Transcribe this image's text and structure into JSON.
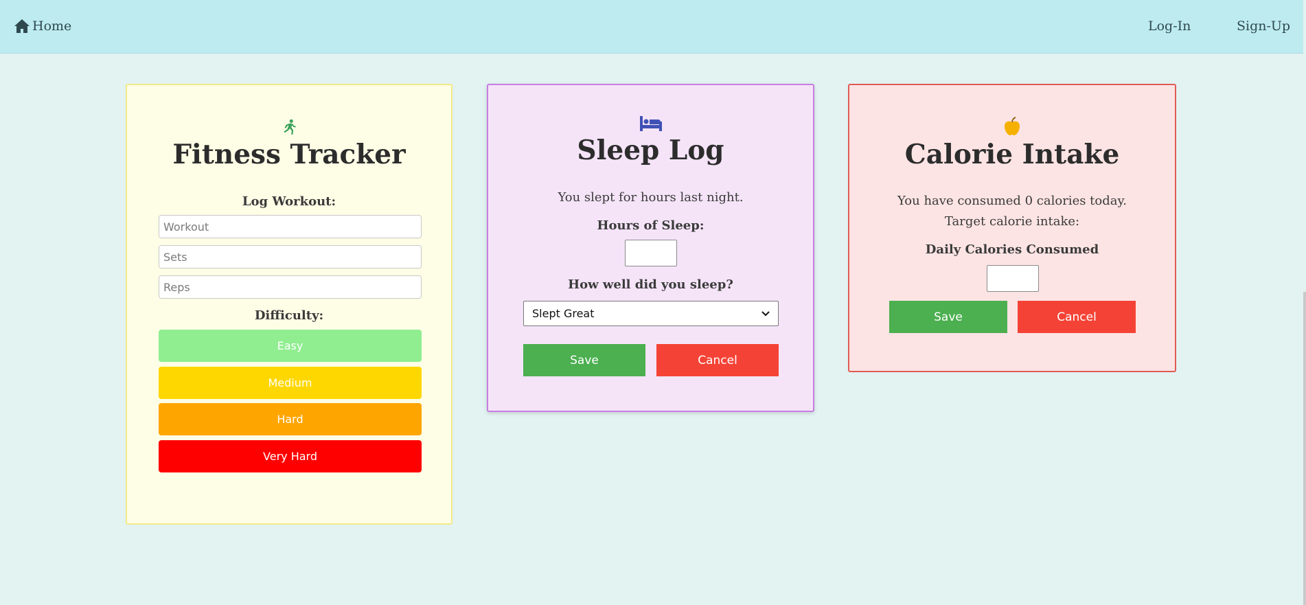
{
  "nav": {
    "home_label": "Home",
    "login_label": "Log-In",
    "signup_label": "Sign-Up"
  },
  "fitness": {
    "icon": "running-person-icon",
    "title": "Fitness Tracker",
    "log_label": "Log Workout:",
    "workout_placeholder": "Workout",
    "sets_placeholder": "Sets",
    "reps_placeholder": "Reps",
    "difficulty_label": "Difficulty:",
    "difficulty_options": [
      {
        "label": "Easy",
        "color": "#90ee90"
      },
      {
        "label": "Medium",
        "color": "#ffd700"
      },
      {
        "label": "Hard",
        "color": "#ffa500"
      },
      {
        "label": "Very Hard",
        "color": "#ff0000"
      }
    ]
  },
  "sleep": {
    "icon": "bed-icon",
    "title": "Sleep Log",
    "summary": "You slept for hours last night.",
    "hours_label": "Hours of Sleep:",
    "quality_label": "How well did you sleep?",
    "quality_selected": "Slept Great",
    "save_label": "Save",
    "cancel_label": "Cancel"
  },
  "calorie": {
    "icon": "apple-icon",
    "title": "Calorie Intake",
    "consumed_text": "You have consumed 0 calories today.",
    "target_text": "Target calorie intake:",
    "daily_label": "Daily Calories Consumed",
    "save_label": "Save",
    "cancel_label": "Cancel"
  },
  "colors": {
    "navbar": "#bdebf0",
    "page_bg": "#e2f3f1",
    "save": "#4caf50",
    "cancel": "#f44336"
  }
}
